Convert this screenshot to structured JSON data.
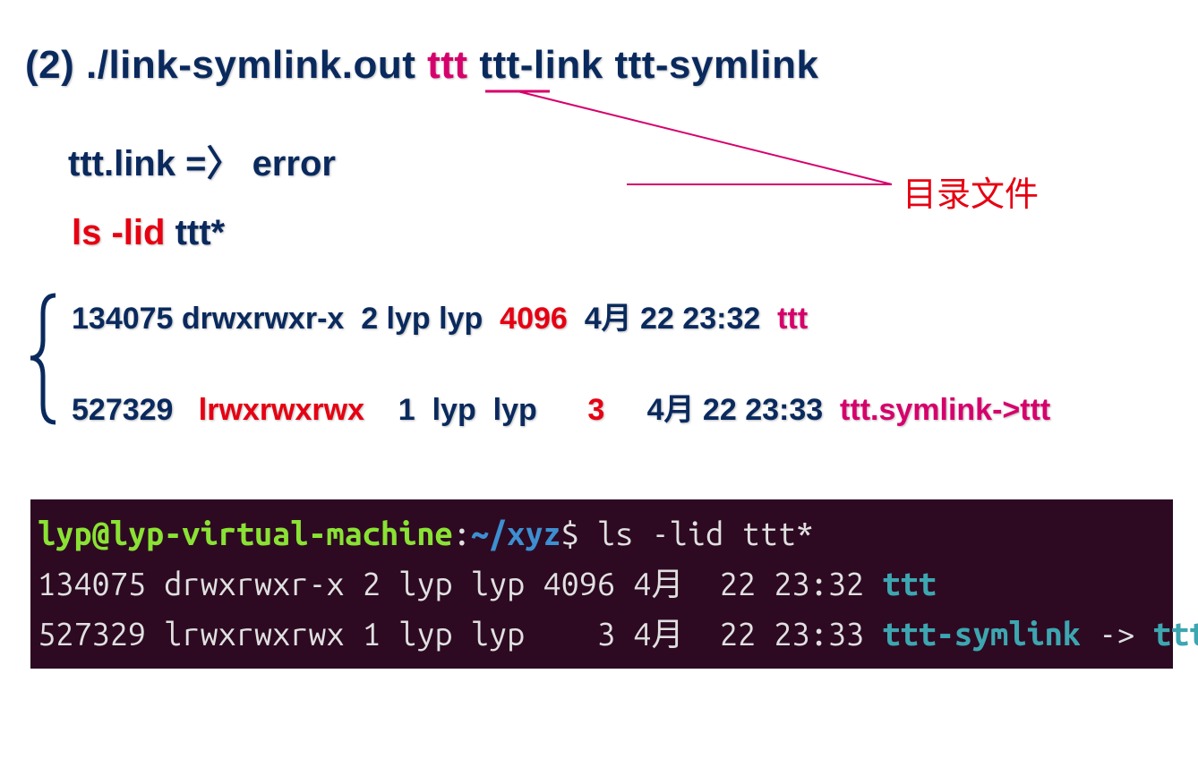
{
  "title": {
    "prefix": "(2) ./link-symlink.out  ",
    "arg1": "ttt",
    "rest": "  ttt-link  ttt-symlink"
  },
  "line2": "ttt.link   =〉  error",
  "line3": {
    "cmd": "ls  -lid",
    "arg": "   ttt*"
  },
  "listing1": {
    "a": "134075 drwxrwxr-x  2 lyp lyp  ",
    "size": "4096",
    "b": "  4月 22 23:32  ",
    "name": "ttt"
  },
  "listing2": {
    "a": "527329   ",
    "perm": "lrwxrwxrwx",
    "b": "    1  lyp  lyp      ",
    "size": "3",
    "c": "     4月 22 23:33  ",
    "name": "ttt.symlink->ttt"
  },
  "annotation": "目录文件",
  "terminal": {
    "user": "lyp@lyp-virtual-machine",
    "path": "~/xyz",
    "cmd": "ls -lid ttt*",
    "row1": {
      "a": "134075 drwxrwxr-x 2 lyp lyp 4096 4月  22 23:32 ",
      "name": "ttt"
    },
    "row2": {
      "a": "527329 lrwxrwxrwx 1 lyp lyp    3 4月  22 23:33 ",
      "name": "ttt-symlink",
      "arrow": " -> ",
      "target": "ttt"
    }
  }
}
